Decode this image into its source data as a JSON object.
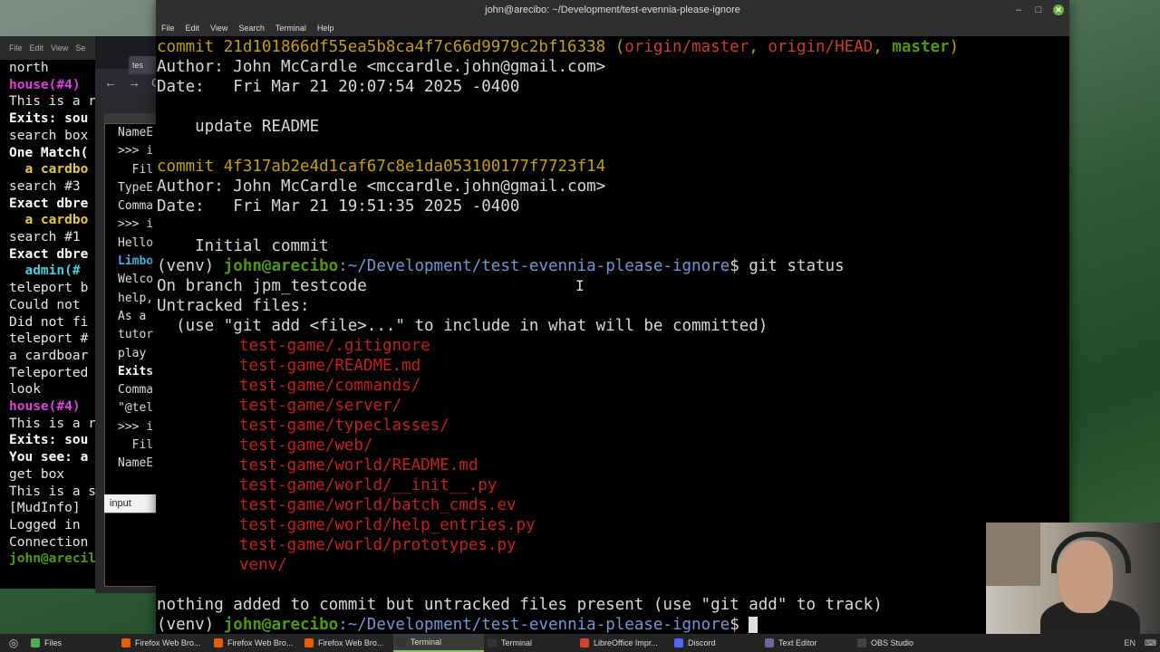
{
  "back_terminal": {
    "menu": [
      "File",
      "Edit",
      "View",
      "Se"
    ],
    "lines": [
      {
        "text": "north",
        "color": "#e6e6e6",
        "bold": false
      },
      {
        "text": "house(#4)",
        "color": "#e040e0",
        "bold": true
      },
      {
        "text": "This is a r",
        "color": "#e6e6e6",
        "bold": false
      },
      {
        "text": "Exits: sou",
        "color": "#ffffff",
        "bold": true
      },
      {
        "text": "search box",
        "color": "#e6e6e6",
        "bold": false
      },
      {
        "text": "One Match(",
        "color": "#ffffff",
        "bold": true
      },
      {
        "text": "  a cardbo",
        "color": "#e8c840",
        "bold": true
      },
      {
        "text": "search #3",
        "color": "#e6e6e6",
        "bold": false
      },
      {
        "text": "Exact dbre",
        "color": "#ffffff",
        "bold": true
      },
      {
        "text": "  a cardbo",
        "color": "#e8c840",
        "bold": true
      },
      {
        "text": "search #1",
        "color": "#e6e6e6",
        "bold": false
      },
      {
        "text": "Exact dbre",
        "color": "#ffffff",
        "bold": true
      },
      {
        "text": "  admin(#",
        "color": "#40d0e0",
        "bold": true
      },
      {
        "text": "teleport b",
        "color": "#e6e6e6",
        "bold": false
      },
      {
        "text": "Could not",
        "color": "#e6e6e6",
        "bold": false
      },
      {
        "text": "Did not fi",
        "color": "#e6e6e6",
        "bold": false
      },
      {
        "text": "teleport #",
        "color": "#e6e6e6",
        "bold": false
      },
      {
        "text": "a cardboar",
        "color": "#e6e6e6",
        "bold": false
      },
      {
        "text": "Teleported",
        "color": "#e6e6e6",
        "bold": false
      },
      {
        "text": "look",
        "color": "#e6e6e6",
        "bold": false
      },
      {
        "text": "house(#4)",
        "color": "#e040e0",
        "bold": true
      },
      {
        "text": "This is a r",
        "color": "#e6e6e6",
        "bold": false
      },
      {
        "text": "Exits: sou",
        "color": "#ffffff",
        "bold": true
      },
      {
        "text": "You see: a",
        "color": "#ffffff",
        "bold": true
      },
      {
        "text": "get box",
        "color": "#e6e6e6",
        "bold": false
      },
      {
        "text": "This is a s",
        "color": "#e6e6e6",
        "bold": false
      },
      {
        "text": "[MudInfo]",
        "color": "#e6e6e6",
        "bold": false
      },
      {
        "text": "Logged in",
        "color": "#e6e6e6",
        "bold": false
      },
      {
        "text": "Connection",
        "color": "#e6e6e6",
        "bold": false
      },
      {
        "text": "john@arecil",
        "color": "#4e9a06",
        "bold": true
      }
    ]
  },
  "back_browser": {
    "tab_label": "tes",
    "nav_icons": [
      "←",
      "→",
      "C"
    ],
    "panel_lines": [
      {
        "text": "NameE",
        "color": "#dddddd",
        "bold": false
      },
      {
        "text": ">>> i",
        "color": "#dddddd",
        "bold": false
      },
      {
        "text": "  Fil",
        "color": "#dddddd",
        "bold": false
      },
      {
        "text": "TypeE",
        "color": "#dddddd",
        "bold": false
      },
      {
        "text": "Comma",
        "color": "#dddddd",
        "bold": false
      },
      {
        "text": ">>> i",
        "color": "#dddddd",
        "bold": false
      },
      {
        "text": "Hello",
        "color": "#dddddd",
        "bold": false
      },
      {
        "text": "Limbo",
        "color": "#40b0e0",
        "bold": true
      },
      {
        "text": "Welco",
        "color": "#dddddd",
        "bold": false
      },
      {
        "text": "help,",
        "color": "#dddddd",
        "bold": false
      },
      {
        "text": "As a",
        "color": "#dddddd",
        "bold": false
      },
      {
        "text": "tutor",
        "color": "#dddddd",
        "bold": false
      },
      {
        "text": "play",
        "color": "#dddddd",
        "bold": false
      },
      {
        "text": "Exits",
        "color": "#ffffff",
        "bold": true
      },
      {
        "text": "Comma",
        "color": "#dddddd",
        "bold": false
      },
      {
        "text": "\"@tel",
        "color": "#dddddd",
        "bold": false
      },
      {
        "text": ">>> i",
        "color": "#dddddd",
        "bold": false
      },
      {
        "text": "  Fil",
        "color": "#dddddd",
        "bold": false
      },
      {
        "text": "NameE",
        "color": "#dddddd",
        "bold": false
      }
    ],
    "input_label": "input"
  },
  "main_terminal": {
    "title": "john@arecibo: ~/Development/test-evennia-please-ignore",
    "menu": [
      "File",
      "Edit",
      "View",
      "Search",
      "Terminal",
      "Help"
    ],
    "commits": [
      {
        "hash_line": "commit 21d101866df55ea5b8ca4f7c66d9979c2bf16338",
        "refs_open": " (",
        "refs": [
          "origin/master",
          "origin/HEAD",
          "master"
        ],
        "author": "Author: John McCardle <mccardle.john@gmail.com>",
        "date": "Date:   Fri Mar 21 20:07:54 2025 -0400",
        "message": "    update README"
      },
      {
        "hash_line": "commit 4f317ab2e4d1caf67c8e1da053100177f7723f14",
        "author": "Author: John McCardle <mccardle.john@gmail.com>",
        "date": "Date:   Fri Mar 21 19:51:35 2025 -0400",
        "message": "    Initial commit"
      }
    ],
    "prompt": {
      "venv": "(venv) ",
      "user_host": "john@arecibo",
      "path": ":~/Development/test-evennia-please-ignore",
      "symbol": "$ ",
      "command": "git status"
    },
    "status": {
      "branch_line": "On branch jpm_testcode",
      "untracked_header": "Untracked files:",
      "hint": "  (use \"git add <file>...\" to include in what will be committed)",
      "files": [
        "test-game/.gitignore",
        "test-game/README.md",
        "test-game/commands/",
        "test-game/server/",
        "test-game/typeclasses/",
        "test-game/web/",
        "test-game/world/README.md",
        "test-game/world/__init__.py",
        "test-game/world/batch_cmds.ev",
        "test-game/world/help_entries.py",
        "test-game/world/prototypes.py",
        "venv/"
      ],
      "footer": "nothing added to commit but untracked files present (use \"git add\" to track)"
    }
  },
  "taskbar": {
    "items": [
      {
        "label": "Files",
        "icon_name": "folder-icon",
        "color": "#4caf50",
        "active": false
      },
      {
        "label": "Firefox Web Bro...",
        "icon_name": "firefox-icon",
        "color": "#e66000",
        "active": false
      },
      {
        "label": "Firefox Web Bro...",
        "icon_name": "firefox-icon",
        "color": "#e66000",
        "active": false
      },
      {
        "label": "Firefox Web Bro...",
        "icon_name": "firefox-icon",
        "color": "#e66000",
        "active": false
      },
      {
        "label": "Terminal",
        "icon_name": "terminal-icon",
        "color": "#333333",
        "active": true
      },
      {
        "label": "Terminal",
        "icon_name": "terminal-icon",
        "color": "#333333",
        "active": false
      },
      {
        "label": "LibreOffice Impr...",
        "icon_name": "libreoffice-impress-icon",
        "color": "#d0482c",
        "active": false
      },
      {
        "label": "Discord",
        "icon_name": "discord-icon",
        "color": "#5865f2",
        "active": false
      },
      {
        "label": "Text Editor",
        "icon_name": "text-editor-icon",
        "color": "#6a6a9a",
        "active": false
      },
      {
        "label": "OBS Studio",
        "icon_name": "obs-icon",
        "color": "#444444",
        "active": false
      }
    ],
    "tray": {
      "lang": "EN"
    }
  }
}
